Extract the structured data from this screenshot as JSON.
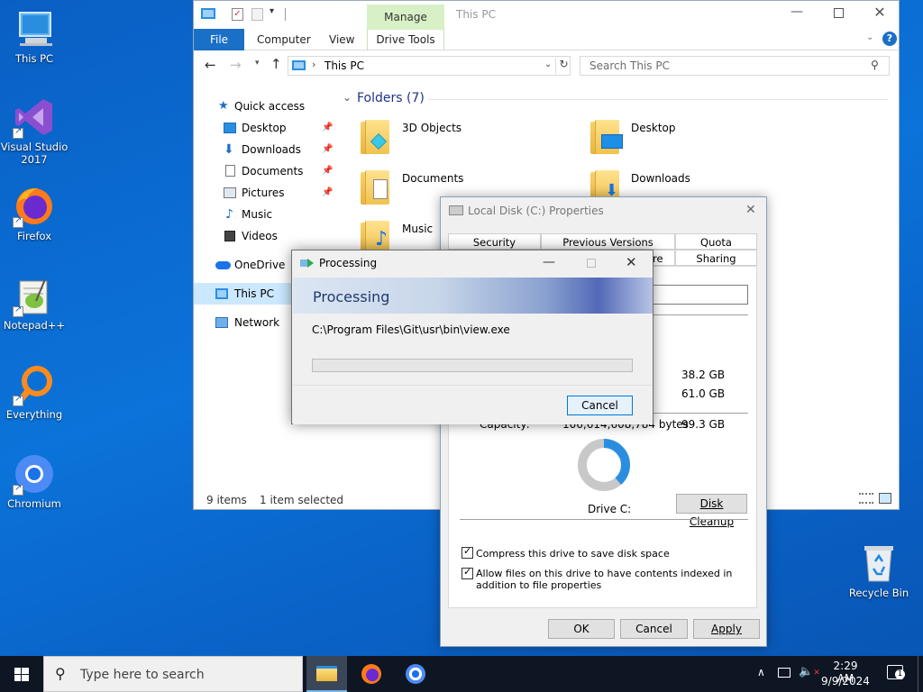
{
  "desktop": {
    "icons": [
      {
        "label": "This PC"
      },
      {
        "label": "Visual Studio 2017"
      },
      {
        "label": "Firefox"
      },
      {
        "label": "Notepad++"
      },
      {
        "label": "Everything"
      },
      {
        "label": "Chromium"
      },
      {
        "label": "Recycle Bin"
      }
    ]
  },
  "explorer": {
    "title": "This PC",
    "context_tab": "Manage",
    "tabs": [
      "File",
      "Computer",
      "View",
      "Drive Tools"
    ],
    "address": "This PC",
    "search_placeholder": "Search This PC",
    "nav": {
      "quick_access": "Quick access",
      "pinned": [
        "Desktop",
        "Downloads",
        "Documents",
        "Pictures"
      ],
      "others": [
        "Music",
        "Videos"
      ],
      "onedrive": "OneDrive",
      "this_pc": "This PC",
      "network": "Network"
    },
    "folders_header": "Folders (7)",
    "folders": [
      "3D Objects",
      "Desktop",
      "Documents",
      "Downloads",
      "Music"
    ],
    "status": {
      "items": "9 items",
      "selected": "1 item selected"
    }
  },
  "properties": {
    "title": "Local Disk (C:) Properties",
    "tabs_row1": [
      "Security",
      "Previous Versions",
      "Quota"
    ],
    "tabs_row2": [
      "re",
      "Sharing"
    ],
    "used_value": "38.2 GB",
    "free_value": "61.0 GB",
    "capacity_label": "Capacity:",
    "capacity_bytes": "106,614,608,784 bytes",
    "capacity_value": "99.3 GB",
    "drive_label": "Drive C:",
    "disk_cleanup": "Disk Cleanup",
    "compress_label": "Compress this drive to save disk space",
    "index_label": "Allow files on this drive to have contents indexed in addition to file properties",
    "ok": "OK",
    "cancel": "Cancel",
    "apply": "Apply",
    "used_fraction": 0.385
  },
  "processing": {
    "title": "Processing",
    "header": "Processing",
    "path": "C:\\Program Files\\Git\\usr\\bin\\view.exe",
    "progress": 0,
    "cancel": "Cancel"
  },
  "taskbar": {
    "search_placeholder": "Type here to search",
    "time": "2:29 AM",
    "date": "9/9/2024",
    "notification_count": "1"
  }
}
